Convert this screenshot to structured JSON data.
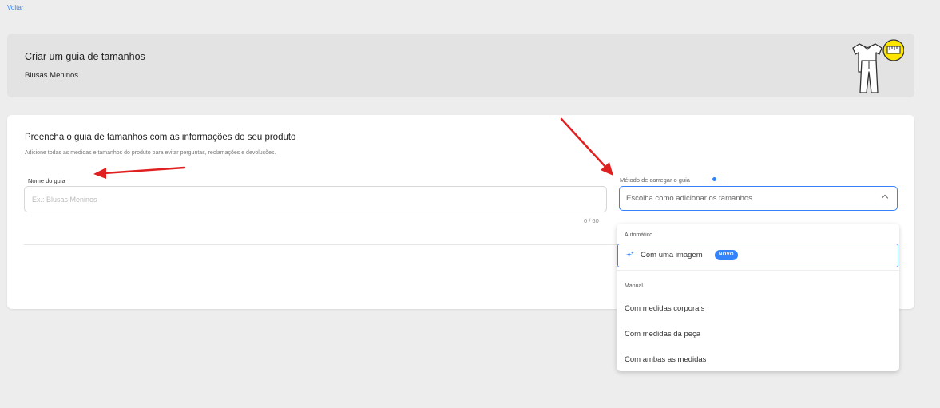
{
  "nav": {
    "back_label": "Voltar"
  },
  "header": {
    "title": "Criar um guia de tamanhos",
    "subtitle": "Blusas Meninos",
    "illustration_icon": "clothing-ruler-icon"
  },
  "form": {
    "title": "Preencha o guia de tamanhos com as informações do seu produto",
    "description": "Adicione todas as medidas e tamanhos do produto para evitar perguntas, reclamações e devoluções.",
    "name_field": {
      "label": "Nome do guia",
      "value": "",
      "placeholder": "Ex.: Blusas Meninos",
      "char_count": "0 / 60"
    },
    "method_field": {
      "label": "Método de carregar o guia",
      "placeholder": "Escolha como adicionar os tamanhos",
      "info_icon": "info-dot-icon",
      "expanded": true
    }
  },
  "dropdown": {
    "groups": [
      {
        "label": "Automático",
        "options": [
          {
            "label": "Com uma imagem",
            "badge": "NOVO",
            "icon": "sparkle-icon",
            "highlighted": true
          }
        ]
      },
      {
        "label": "Manual",
        "options": [
          {
            "label": "Com medidas corporais"
          },
          {
            "label": "Com medidas da peça"
          },
          {
            "label": "Com ambas as medidas"
          }
        ]
      }
    ]
  },
  "colors": {
    "accent": "#3483fa",
    "annotation_arrow": "#e02020",
    "header_bg": "#e3e3e3",
    "page_bg": "#ededed"
  }
}
